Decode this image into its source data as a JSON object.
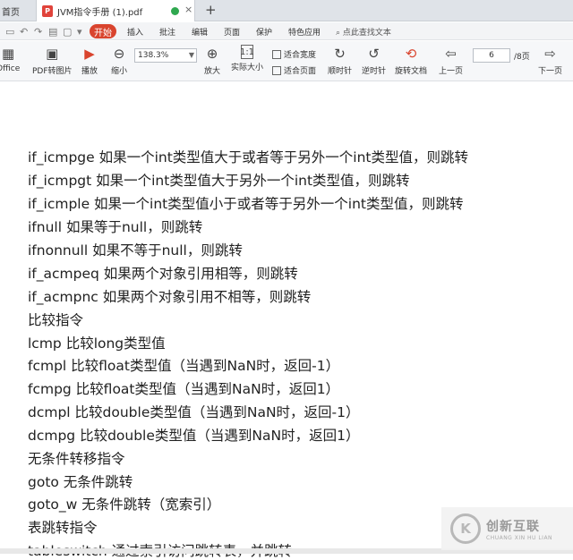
{
  "tabs": {
    "prev_label": "首页",
    "active_title": "JVM指令手册 (1).pdf",
    "pdf_badge": "P",
    "close": "×",
    "add": "+"
  },
  "menubar": {
    "start": "开始",
    "items": [
      "插入",
      "批注",
      "编辑",
      "页面",
      "保护",
      "特色应用"
    ],
    "search": "点此查找文本"
  },
  "toolbar": {
    "office": "Office",
    "pdf_to_image": "PDF转图片",
    "play": "播放",
    "zoom_out": "缩小",
    "zoom_value": "138.3%",
    "zoom_in": "放大",
    "actual_size": "实际大小",
    "fit_width": "适合宽度",
    "fit_page": "适合页面",
    "rotate_cw": "顺时针",
    "rotate_ccw": "逆时针",
    "rotate_doc": "旋转文档",
    "prev_page": "上一页",
    "page_current": "6",
    "page_total": "/8页",
    "next_page": "下一页"
  },
  "document": {
    "lines": [
      "if_icmpge 如果一个int类型值大于或者等于另外一个int类型值，则跳转",
      "if_icmpgt 如果一个int类型值大于另外一个int类型值，则跳转",
      "if_icmple 如果一个int类型值小于或者等于另外一个int类型值，则跳转",
      "ifnull 如果等于null，则跳转",
      "ifnonnull 如果不等于null，则跳转",
      "if_acmpeq 如果两个对象引用相等，则跳转",
      "if_acmpnc 如果两个对象引用不相等，则跳转",
      "比较指令",
      "lcmp 比较long类型值",
      "fcmpl 比较float类型值（当遇到NaN时，返回-1）",
      "fcmpg 比较float类型值（当遇到NaN时，返回1）",
      "dcmpl 比较double类型值（当遇到NaN时，返回-1）",
      "dcmpg 比较double类型值（当遇到NaN时，返回1）",
      "无条件转移指令",
      "goto 无条件跳转",
      "goto_w 无条件跳转（宽索引）",
      "表跳转指令",
      "tableswitch 通过索引访问跳转表，并跳转"
    ]
  },
  "watermark": {
    "symbol": "K",
    "name": "创新互联",
    "pinyin": "CHUANG XIN HU LIAN"
  }
}
